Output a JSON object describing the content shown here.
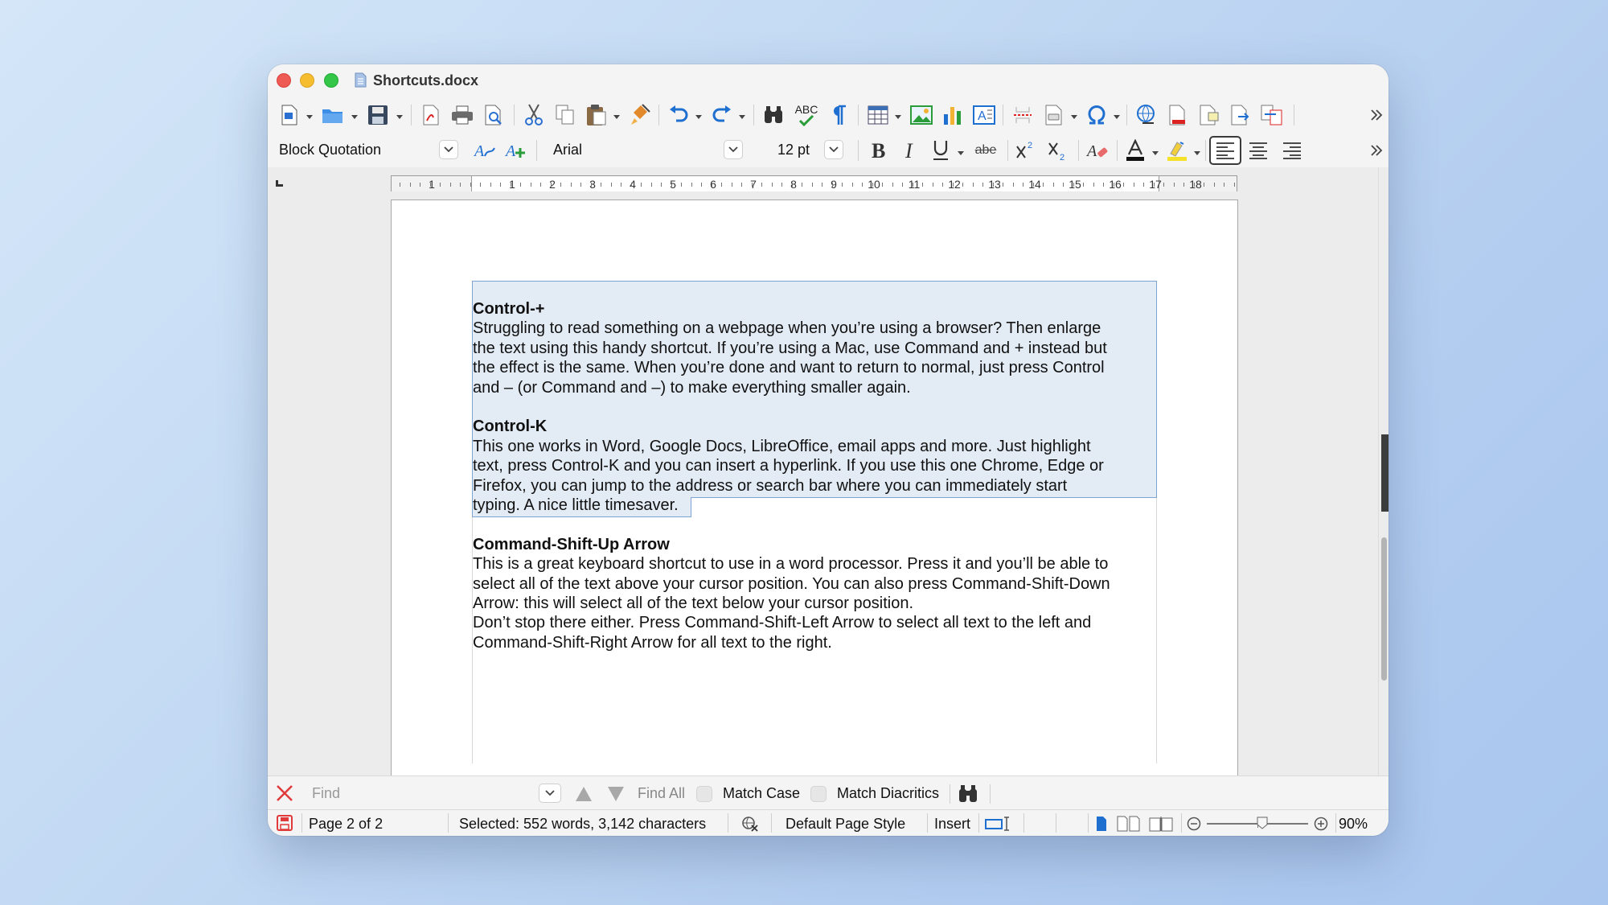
{
  "window": {
    "title": "Shortcuts.docx"
  },
  "formatting": {
    "paragraph_style": "Block Quotation",
    "font_name": "Arial",
    "font_size": "12 pt",
    "strikethrough_glyph": "abe",
    "spellcheck_glyph": "ABC"
  },
  "ruler": {
    "labels": [
      "1",
      "1",
      "2",
      "3",
      "4",
      "5",
      "6",
      "7",
      "8",
      "9",
      "10",
      "11",
      "12",
      "13",
      "14",
      "15",
      "16",
      "17",
      "18"
    ]
  },
  "document": {
    "sections": [
      {
        "heading": "Control-+",
        "lines": [
          "Struggling to read something on a webpage when you’re using a browser? Then enlarge",
          "the text using this handy shortcut. If you’re using a Mac, use Command and + instead but",
          "the effect is the same. When you’re done and want to return to normal, just press Control",
          "and – (or Command and –) to make everything smaller again."
        ]
      },
      {
        "heading": "Control-K",
        "lines": [
          "This one works in Word, Google Docs, LibreOffice, email apps and more.  Just highlight",
          "text, press Control-K and you can insert a hyperlink. If you use this one Chrome, Edge or",
          "Firefox, you can jump to the address or search bar where you can immediately start",
          "typing. A nice little timesaver."
        ]
      },
      {
        "heading": "Command-Shift-Up Arrow",
        "lines": [
          "This is a great keyboard shortcut to use in a word processor. Press it and you’ll be able to",
          "select all of the text above your cursor position. You can also press Command-Shift-Down",
          "Arrow: this will select all of the text below your cursor position.",
          "Don’t stop there either. Press Command-Shift-Left Arrow to select all text to the left and",
          "Command-Shift-Right Arrow for all text to the right."
        ]
      }
    ]
  },
  "findbar": {
    "placeholder": "Find",
    "find_all": "Find All",
    "match_case": "Match Case",
    "match_diacritics": "Match Diacritics"
  },
  "status": {
    "page": "Page 2 of 2",
    "selection": "Selected: 552 words, 3,142 characters",
    "page_style": "Default Page Style",
    "mode": "Insert",
    "zoom": "90%",
    "zoom_level": 0.55
  },
  "colors": {
    "selection": "#e3ebf5",
    "selection_border": "#7ea4d3",
    "accent_blue": "#1f6fd1",
    "close_red": "#ee5b54"
  }
}
